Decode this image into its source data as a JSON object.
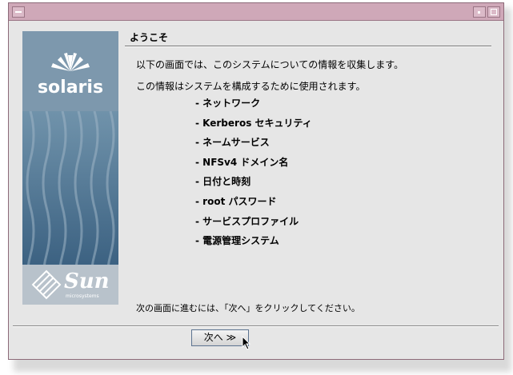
{
  "window": {
    "title": ""
  },
  "sidebar": {
    "logo_text": "solaris",
    "vendor_logo": "Sun",
    "vendor_sub": "microsystems"
  },
  "main": {
    "title": "ようこそ",
    "intro_line1": "以下の画面では、このシステムについての情報を収集します。",
    "intro_line2": "この情報はシステムを構成するために使用されます。",
    "items": [
      "- ネットワーク",
      "- Kerberos セキュリティ",
      "- ネームサービス",
      "- NFSv4 ドメイン名",
      "- 日付と時刻",
      "- root パスワード",
      "- サービスプロファイル",
      "- 電源管理システム"
    ],
    "footer": "次の画面に進むには、「次へ」をクリックしてください。"
  },
  "buttons": {
    "next_label": "次へ ≫"
  },
  "colors": {
    "titlebar": "#cfa8b8",
    "window_bg": "#e6e6e6",
    "sidebar_top": "#88a6ba",
    "sidebar_bottom": "#2f5577"
  },
  "icons": {
    "window_menu": "window-menu-icon",
    "minimize": "minimize-icon",
    "maximize": "maximize-icon",
    "sun_rays": "sun-rays-icon",
    "sun_diamond": "sun-diamond-icon",
    "cursor": "mouse-pointer-icon"
  }
}
